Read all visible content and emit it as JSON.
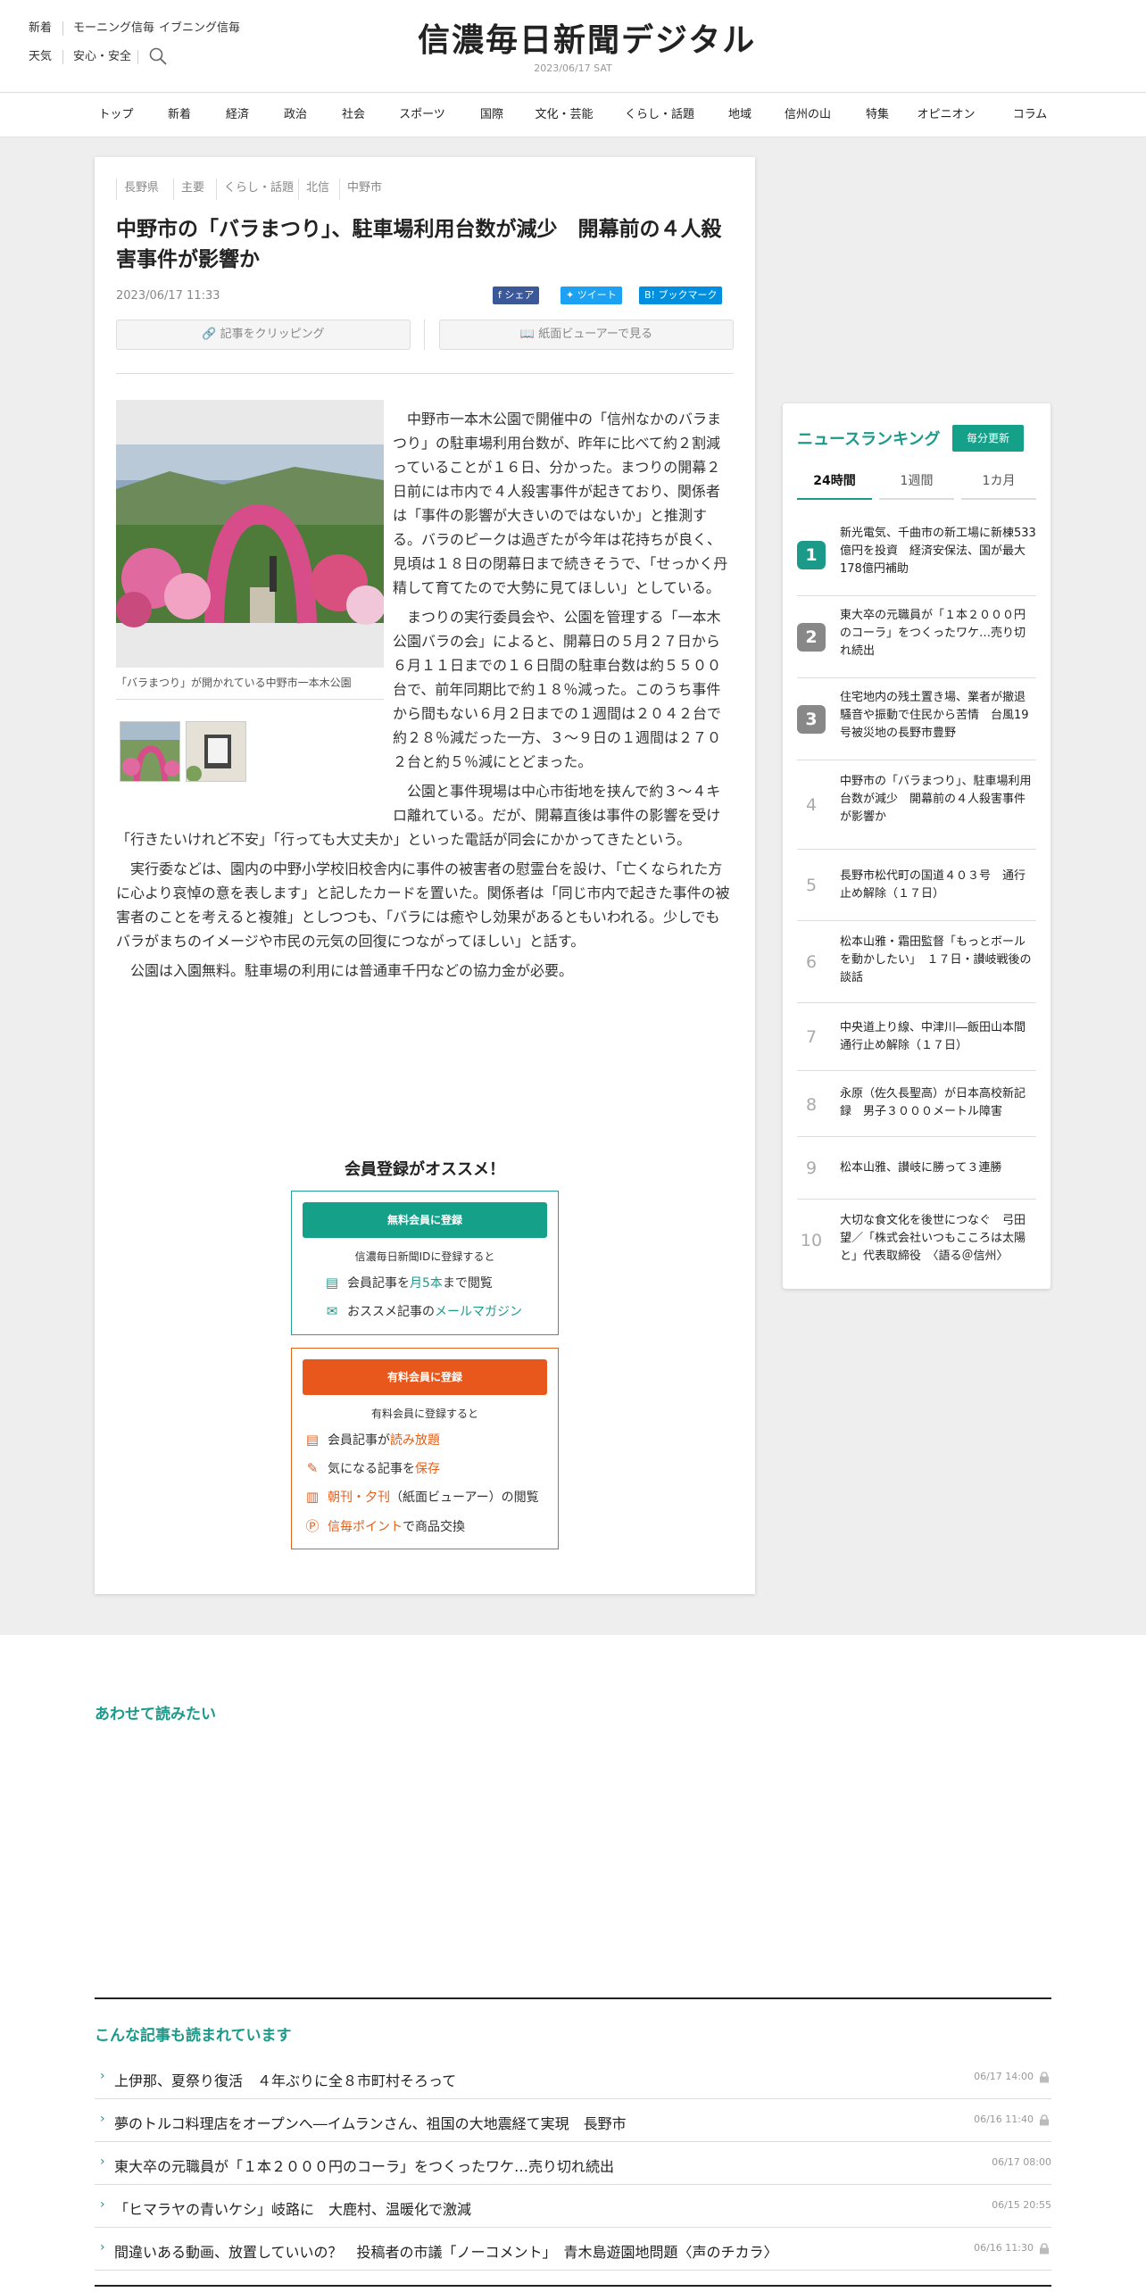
{
  "header": {
    "top_links": [
      "新着",
      "モーニング信毎",
      "イブニング信毎"
    ],
    "sub_links": [
      "天気",
      "安心・安全"
    ],
    "search_icon": "search-icon",
    "logo": "信濃毎日新聞デジタル",
    "date": "2023/06/17 SAT"
  },
  "nav": [
    "トップ",
    "新着",
    "経済",
    "政治",
    "社会",
    "スポーツ",
    "国際",
    "文化・芸能",
    "くらし・話題",
    "地域",
    "信州の山",
    "特集",
    "オピニオン",
    "コラム"
  ],
  "article": {
    "tags": [
      "長野県",
      "主要",
      "くらし・話題",
      "北信",
      "中野市"
    ],
    "title": "中野市の「バラまつり」、駐車場利用台数が減少　開幕前の４人殺害事件が影響か",
    "date": "2023/06/17 11:33",
    "share": {
      "facebook": "シェア",
      "twitter": "ツイート",
      "hatena": "ブックマーク"
    },
    "clip_button": "記事をクリッピング",
    "viewer_button": "紙面ビューアーで見る",
    "caption": "「バラまつり」が開かれている中野市一本木公園",
    "paragraphs": [
      "中野市一本木公園で開催中の「信州なかのバラまつり」の駐車場利用台数が、昨年に比べて約２割減っていることが１６日、分かった。まつりの開幕２日前には市内で４人殺害事件が起きており、関係者は「事件の影響が大きいのではないか」と推測する。バラのピークは過ぎたが今年は花持ちが良く、見頃は１８日の閉幕日まで続きそうで、「せっかく丹精して育てたので大勢に見てほしい」としている。",
      "まつりの実行委員会や、公園を管理する「一本木公園バラの会」によると、開幕日の５月２７日から６月１１日までの１６日間の駐車台数は約５５００台で、前年同期比で約１８％減った。このうち事件から間もない６月２日までの１週間は２０４２台で約２８％減だった一方、３～９日の１週間は２７０２台と約５％減にとどまった。",
      "公園と事件現場は中心市街地を挟んで約３～４キロ離れている。だが、開幕直後は事件の影響を受け「行きたいけれど不安」「行っても大丈夫か」といった電話が同会にかかってきたという。",
      "実行委などは、園内の中野小学校旧校舎内に事件の被害者の慰霊台を設け、「亡くなられた方に心より哀悼の意を表します」と記したカードを置いた。関係者は「同じ市内で起きた事件の被害者のことを考えると複雑」としつつも、「バラには癒やし効果があるともいわれる。少しでもバラがまちのイメージや市民の元気の回復につながってほしい」と話す。",
      "公園は入園無料。駐車場の利用には普通車千円などの協力金が必要。"
    ]
  },
  "membership": {
    "heading": "会員登録がオススメ！",
    "free": {
      "button": "無料会員に登録",
      "sub": "信濃毎日新聞IDに登録すると",
      "line1_pre": "会員記事を",
      "line1_hl": "月5本",
      "line1_post": "まで閲覧",
      "line2_pre": "おススメ記事の",
      "line2_hl": "メールマガジン"
    },
    "paid": {
      "button": "有料会員に登録",
      "sub": "有料会員に登録すると",
      "line1_pre": "会員記事が",
      "line1_hl": "読み放題",
      "line2_pre": "気になる記事を",
      "line2_hl": "保存",
      "line3_hl": "朝刊・夕刊",
      "line3_post": "（紙面ビューアー）の閲覧",
      "line4_hl": "信毎ポイント",
      "line4_post": "で商品交換"
    }
  },
  "ranking": {
    "title": "ニュースランキング",
    "badge": "毎分更新",
    "tabs": [
      "24時間",
      "1週間",
      "1カ月"
    ],
    "items": [
      {
        "num": "1",
        "text": "新光電気、千曲市の新工場に新棟533億円を投資　経済安保法、国が最大178億円補助"
      },
      {
        "num": "2",
        "text": "東大卒の元職員が「１本２０００円のコーラ」をつくったワケ…売り切れ続出"
      },
      {
        "num": "3",
        "text": "住宅地内の残土置き場、業者が撤退　騒音や振動で住民から苦情　台風19号被災地の長野市豊野"
      },
      {
        "num": "4",
        "text": "中野市の「バラまつり」、駐車場利用台数が減少　開幕前の４人殺害事件が影響か"
      },
      {
        "num": "5",
        "text": "長野市松代町の国道４０３号　通行止め解除（１７日）"
      },
      {
        "num": "6",
        "text": "松本山雅・霜田監督「もっとボールを動かしたい」　１７日・讃岐戦後の談話"
      },
      {
        "num": "7",
        "text": "中央道上り線、中津川―飯田山本間　通行止め解除（１７日）"
      },
      {
        "num": "8",
        "text": "永原（佐久長聖高）が日本高校新記録　男子３０００メートル障害"
      },
      {
        "num": "9",
        "text": "松本山雅、讃岐に勝って３連勝"
      },
      {
        "num": "10",
        "text": "大切な食文化を後世につなぐ　弓田望／「株式会社いつもこころは太陽と」代表取締役　〈語る＠信州〉"
      }
    ]
  },
  "also_read": {
    "title": "あわせて読みたい"
  },
  "popular": {
    "title": "こんな記事も読まれています",
    "items": [
      {
        "text": "上伊那、夏祭り復活　４年ぶりに全８市町村そろって",
        "date": "06/17 14:00"
      },
      {
        "text": "夢のトルコ料理店をオープンへ―イムランさん、祖国の大地震経て実現　長野市",
        "date": "06/16 11:40"
      },
      {
        "text": "東大卒の元職員が「１本２０００円のコーラ」をつくったワケ…売り切れ続出",
        "date": "06/17 08:00"
      },
      {
        "text": "「ヒマラヤの青いケシ」岐路に　大鹿村、温暖化で激減",
        "date": "06/15 20:55"
      },
      {
        "text": "間違いある動画、放置していいの？　投稿者の市議「ノーコメント」　青木島遊園地問題〈声のチカラ〉",
        "date": "06/16 11:30"
      }
    ]
  },
  "colors": {
    "accent": "#1b9a8a",
    "orange": "#e0601c",
    "facebook": "#3b5998",
    "twitter": "#1da1f2",
    "hatena": "#008fde"
  }
}
